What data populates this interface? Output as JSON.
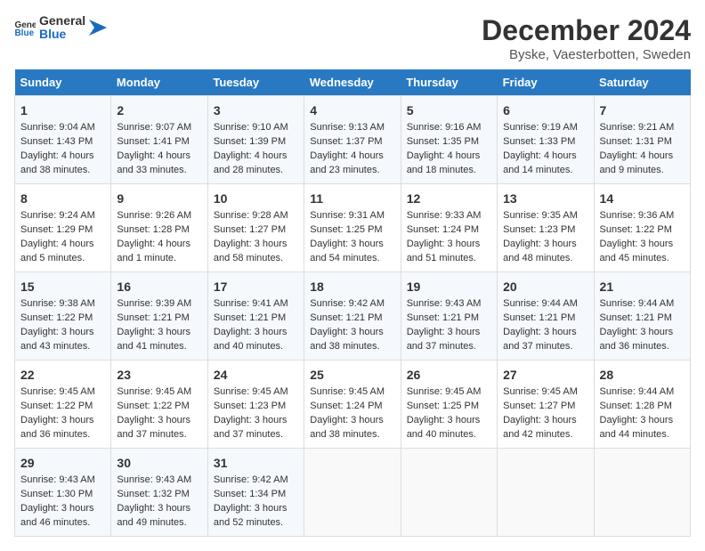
{
  "logo": {
    "text_general": "General",
    "text_blue": "Blue"
  },
  "title": "December 2024",
  "subtitle": "Byske, Vaesterbotten, Sweden",
  "days_of_week": [
    "Sunday",
    "Monday",
    "Tuesday",
    "Wednesday",
    "Thursday",
    "Friday",
    "Saturday"
  ],
  "weeks": [
    [
      {
        "day": "1",
        "sunrise": "Sunrise: 9:04 AM",
        "sunset": "Sunset: 1:43 PM",
        "daylight": "Daylight: 4 hours and 38 minutes."
      },
      {
        "day": "2",
        "sunrise": "Sunrise: 9:07 AM",
        "sunset": "Sunset: 1:41 PM",
        "daylight": "Daylight: 4 hours and 33 minutes."
      },
      {
        "day": "3",
        "sunrise": "Sunrise: 9:10 AM",
        "sunset": "Sunset: 1:39 PM",
        "daylight": "Daylight: 4 hours and 28 minutes."
      },
      {
        "day": "4",
        "sunrise": "Sunrise: 9:13 AM",
        "sunset": "Sunset: 1:37 PM",
        "daylight": "Daylight: 4 hours and 23 minutes."
      },
      {
        "day": "5",
        "sunrise": "Sunrise: 9:16 AM",
        "sunset": "Sunset: 1:35 PM",
        "daylight": "Daylight: 4 hours and 18 minutes."
      },
      {
        "day": "6",
        "sunrise": "Sunrise: 9:19 AM",
        "sunset": "Sunset: 1:33 PM",
        "daylight": "Daylight: 4 hours and 14 minutes."
      },
      {
        "day": "7",
        "sunrise": "Sunrise: 9:21 AM",
        "sunset": "Sunset: 1:31 PM",
        "daylight": "Daylight: 4 hours and 9 minutes."
      }
    ],
    [
      {
        "day": "8",
        "sunrise": "Sunrise: 9:24 AM",
        "sunset": "Sunset: 1:29 PM",
        "daylight": "Daylight: 4 hours and 5 minutes."
      },
      {
        "day": "9",
        "sunrise": "Sunrise: 9:26 AM",
        "sunset": "Sunset: 1:28 PM",
        "daylight": "Daylight: 4 hours and 1 minute."
      },
      {
        "day": "10",
        "sunrise": "Sunrise: 9:28 AM",
        "sunset": "Sunset: 1:27 PM",
        "daylight": "Daylight: 3 hours and 58 minutes."
      },
      {
        "day": "11",
        "sunrise": "Sunrise: 9:31 AM",
        "sunset": "Sunset: 1:25 PM",
        "daylight": "Daylight: 3 hours and 54 minutes."
      },
      {
        "day": "12",
        "sunrise": "Sunrise: 9:33 AM",
        "sunset": "Sunset: 1:24 PM",
        "daylight": "Daylight: 3 hours and 51 minutes."
      },
      {
        "day": "13",
        "sunrise": "Sunrise: 9:35 AM",
        "sunset": "Sunset: 1:23 PM",
        "daylight": "Daylight: 3 hours and 48 minutes."
      },
      {
        "day": "14",
        "sunrise": "Sunrise: 9:36 AM",
        "sunset": "Sunset: 1:22 PM",
        "daylight": "Daylight: 3 hours and 45 minutes."
      }
    ],
    [
      {
        "day": "15",
        "sunrise": "Sunrise: 9:38 AM",
        "sunset": "Sunset: 1:22 PM",
        "daylight": "Daylight: 3 hours and 43 minutes."
      },
      {
        "day": "16",
        "sunrise": "Sunrise: 9:39 AM",
        "sunset": "Sunset: 1:21 PM",
        "daylight": "Daylight: 3 hours and 41 minutes."
      },
      {
        "day": "17",
        "sunrise": "Sunrise: 9:41 AM",
        "sunset": "Sunset: 1:21 PM",
        "daylight": "Daylight: 3 hours and 40 minutes."
      },
      {
        "day": "18",
        "sunrise": "Sunrise: 9:42 AM",
        "sunset": "Sunset: 1:21 PM",
        "daylight": "Daylight: 3 hours and 38 minutes."
      },
      {
        "day": "19",
        "sunrise": "Sunrise: 9:43 AM",
        "sunset": "Sunset: 1:21 PM",
        "daylight": "Daylight: 3 hours and 37 minutes."
      },
      {
        "day": "20",
        "sunrise": "Sunrise: 9:44 AM",
        "sunset": "Sunset: 1:21 PM",
        "daylight": "Daylight: 3 hours and 37 minutes."
      },
      {
        "day": "21",
        "sunrise": "Sunrise: 9:44 AM",
        "sunset": "Sunset: 1:21 PM",
        "daylight": "Daylight: 3 hours and 36 minutes."
      }
    ],
    [
      {
        "day": "22",
        "sunrise": "Sunrise: 9:45 AM",
        "sunset": "Sunset: 1:22 PM",
        "daylight": "Daylight: 3 hours and 36 minutes."
      },
      {
        "day": "23",
        "sunrise": "Sunrise: 9:45 AM",
        "sunset": "Sunset: 1:22 PM",
        "daylight": "Daylight: 3 hours and 37 minutes."
      },
      {
        "day": "24",
        "sunrise": "Sunrise: 9:45 AM",
        "sunset": "Sunset: 1:23 PM",
        "daylight": "Daylight: 3 hours and 37 minutes."
      },
      {
        "day": "25",
        "sunrise": "Sunrise: 9:45 AM",
        "sunset": "Sunset: 1:24 PM",
        "daylight": "Daylight: 3 hours and 38 minutes."
      },
      {
        "day": "26",
        "sunrise": "Sunrise: 9:45 AM",
        "sunset": "Sunset: 1:25 PM",
        "daylight": "Daylight: 3 hours and 40 minutes."
      },
      {
        "day": "27",
        "sunrise": "Sunrise: 9:45 AM",
        "sunset": "Sunset: 1:27 PM",
        "daylight": "Daylight: 3 hours and 42 minutes."
      },
      {
        "day": "28",
        "sunrise": "Sunrise: 9:44 AM",
        "sunset": "Sunset: 1:28 PM",
        "daylight": "Daylight: 3 hours and 44 minutes."
      }
    ],
    [
      {
        "day": "29",
        "sunrise": "Sunrise: 9:43 AM",
        "sunset": "Sunset: 1:30 PM",
        "daylight": "Daylight: 3 hours and 46 minutes."
      },
      {
        "day": "30",
        "sunrise": "Sunrise: 9:43 AM",
        "sunset": "Sunset: 1:32 PM",
        "daylight": "Daylight: 3 hours and 49 minutes."
      },
      {
        "day": "31",
        "sunrise": "Sunrise: 9:42 AM",
        "sunset": "Sunset: 1:34 PM",
        "daylight": "Daylight: 3 hours and 52 minutes."
      },
      null,
      null,
      null,
      null
    ]
  ]
}
